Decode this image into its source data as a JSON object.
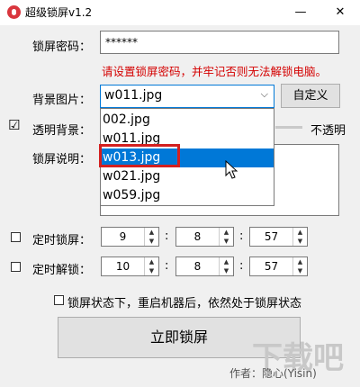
{
  "window": {
    "title": "超级锁屏v1.2",
    "minimize": "—",
    "close": "✕"
  },
  "password": {
    "label": "锁屏密码：",
    "value": "******",
    "warning": "请设置锁屏密码，并牢记否则无法解锁电脑。"
  },
  "background": {
    "label": "背景图片：",
    "selected": "w011.jpg",
    "custom_button": "自定义",
    "options": [
      "002.jpg",
      "w011.jpg",
      "w013.jpg",
      "w021.jpg",
      "w059.jpg"
    ],
    "highlighted_index": 2
  },
  "transparent": {
    "label": "透明背景：",
    "checked": true,
    "check_mark": "☑",
    "right_label": "不透明"
  },
  "lock_desc": {
    "label": "锁屏说明："
  },
  "timed_lock": {
    "label": "定时锁屏：",
    "hour": "9",
    "minute": "8",
    "second": "57"
  },
  "timed_unlock": {
    "label": "定时解锁：",
    "hour": "10",
    "minute": "8",
    "second": "57"
  },
  "separator": ":",
  "spin_up": "▲",
  "spin_down": "▼",
  "restart_option": {
    "label": "锁屏状态下，重启机器后，依然处于锁屏状态"
  },
  "lock_now_button": "立即锁屏",
  "author": "作者：隐心(Yisin)",
  "watermark": "下载吧",
  "colors": {
    "accent": "#0078d7",
    "warning": "#d40000",
    "highlight_box": "#d32020"
  }
}
